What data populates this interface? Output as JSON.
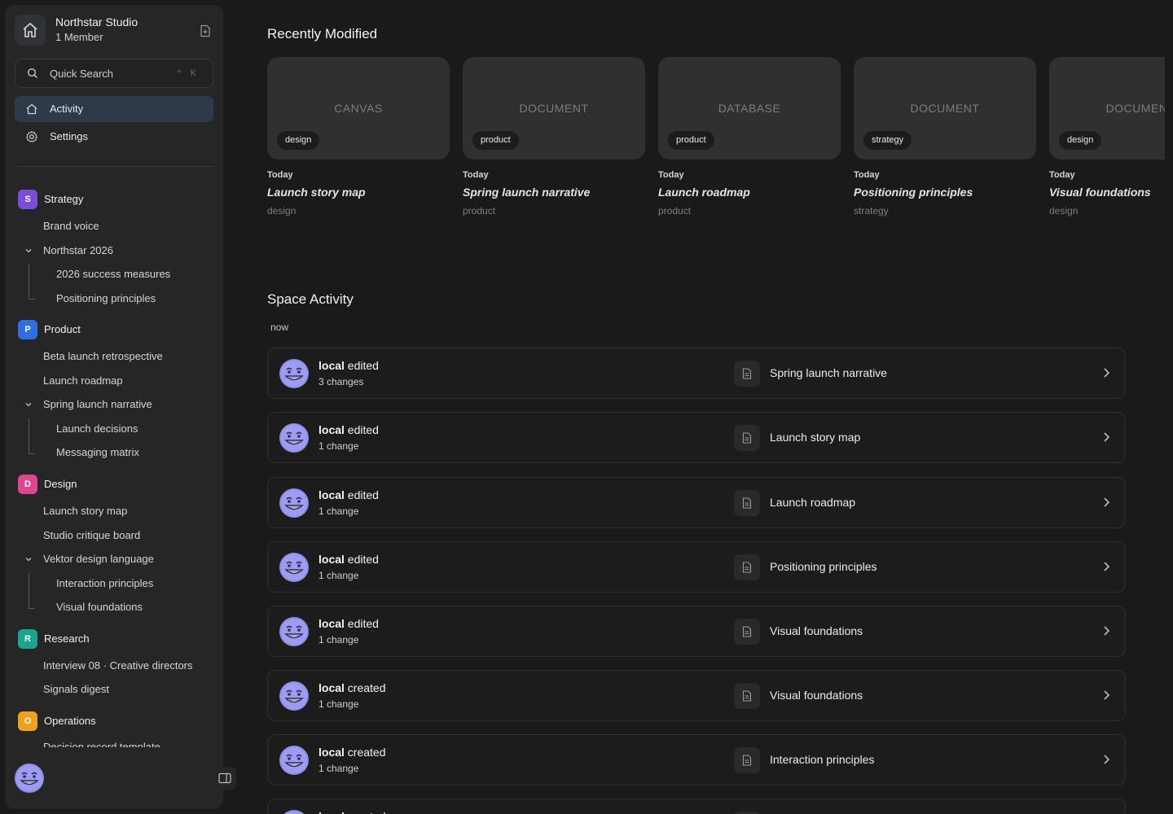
{
  "workspace": {
    "name": "Northstar Studio",
    "members": "1 Member"
  },
  "search": {
    "label": "Quick Search",
    "shortcut": "^ K"
  },
  "nav": [
    {
      "label": "Activity",
      "icon": "home-icon",
      "active": true
    },
    {
      "label": "Settings",
      "icon": "gear-icon",
      "active": false
    }
  ],
  "spaces": [
    {
      "letter": "S",
      "label": "Strategy",
      "color": "#7c4ddb"
    },
    {
      "letter": "P",
      "label": "Product",
      "color": "#2f6fe4"
    },
    {
      "letter": "D",
      "label": "Design",
      "color": "#e0468f"
    },
    {
      "letter": "R",
      "label": "Research",
      "color": "#1aa58e"
    },
    {
      "letter": "O",
      "label": "Operations",
      "color": "#f0a020"
    }
  ],
  "tree": {
    "strategy": [
      "Brand voice",
      "Northstar 2026",
      "2026 success measures",
      "Positioning principles"
    ],
    "product": [
      "Beta launch retrospective",
      "Launch roadmap",
      "Spring launch narrative",
      "Launch decisions",
      "Messaging matrix"
    ],
    "design": [
      "Launch story map",
      "Studio critique board",
      "Vektor design language",
      "Interaction principles",
      "Visual foundations"
    ],
    "research": [
      "Interview 08 · Creative directors",
      "Signals digest"
    ],
    "operations": [
      "Decision record template"
    ]
  },
  "recent": {
    "title": "Recently Modified",
    "cards": [
      {
        "type": "CANVAS",
        "tag": "design",
        "date": "Today",
        "title": "Launch story map",
        "space": "design"
      },
      {
        "type": "DOCUMENT",
        "tag": "product",
        "date": "Today",
        "title": "Spring launch narrative",
        "space": "product"
      },
      {
        "type": "DATABASE",
        "tag": "product",
        "date": "Today",
        "title": "Launch roadmap",
        "space": "product"
      },
      {
        "type": "DOCUMENT",
        "tag": "strategy",
        "date": "Today",
        "title": "Positioning principles",
        "space": "strategy"
      },
      {
        "type": "DOCUMENT",
        "tag": "design",
        "date": "Today",
        "title": "Visual foundations",
        "space": "design"
      }
    ]
  },
  "activity": {
    "title": "Space Activity",
    "group_label": "now",
    "rows": [
      {
        "actor": "local",
        "action": "edited",
        "changes": "3 changes",
        "doc": "Spring launch narrative"
      },
      {
        "actor": "local",
        "action": "edited",
        "changes": "1 change",
        "doc": "Launch story map"
      },
      {
        "actor": "local",
        "action": "edited",
        "changes": "1 change",
        "doc": "Launch roadmap"
      },
      {
        "actor": "local",
        "action": "edited",
        "changes": "1 change",
        "doc": "Positioning principles"
      },
      {
        "actor": "local",
        "action": "edited",
        "changes": "1 change",
        "doc": "Visual foundations"
      },
      {
        "actor": "local",
        "action": "created",
        "changes": "1 change",
        "doc": "Visual foundations"
      },
      {
        "actor": "local",
        "action": "created",
        "changes": "1 change",
        "doc": "Interaction principles"
      },
      {
        "actor": "local",
        "action": "created",
        "changes": "",
        "doc": ""
      }
    ]
  }
}
